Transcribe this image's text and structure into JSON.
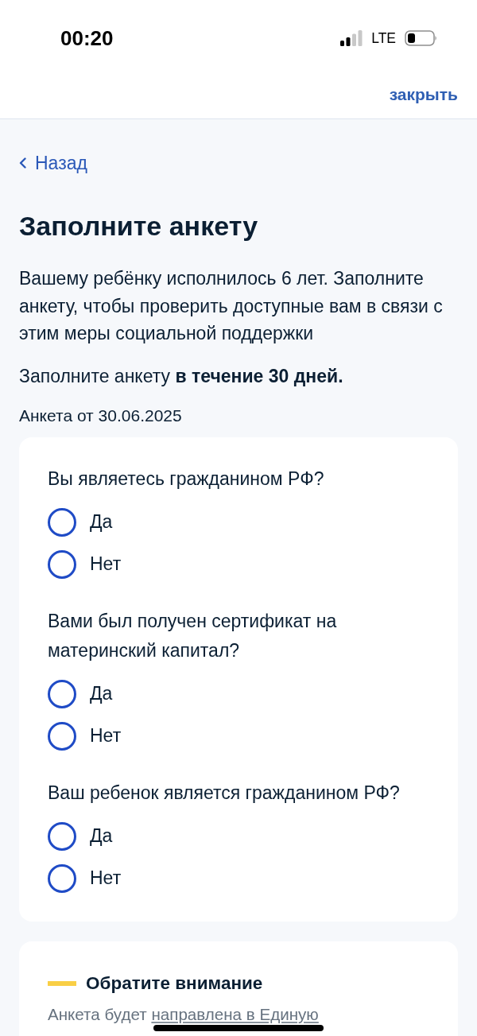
{
  "status_bar": {
    "time": "00:20",
    "network": "LTE"
  },
  "header": {
    "close_label": "закрыть"
  },
  "back_link": {
    "label": "Назад"
  },
  "title": "Заполните анкету",
  "intro": "Вашему ребёнку исполнилось 6 лет. Заполните анкету, чтобы проверить доступные вам в связи с этим меры социальной поддержки",
  "deadline": "Заполните анкету **в течение 30 дней.**",
  "form_date": "Анкета от 30.06.2025",
  "questions": [
    {
      "text": "Вы являетесь гражданином РФ?",
      "options": [
        {
          "label": "Да",
          "selected": false
        },
        {
          "label": "Нет",
          "selected": false
        }
      ]
    },
    {
      "text": "Вами был получен сертификат на материнский капитал?",
      "options": [
        {
          "label": "Да",
          "selected": false
        },
        {
          "label": "Нет",
          "selected": false
        }
      ]
    },
    {
      "text": "Ваш ребенок является гражданином РФ?",
      "options": [
        {
          "label": "Да",
          "selected": false
        },
        {
          "label": "Нет",
          "selected": false
        }
      ]
    }
  ],
  "notice": {
    "title": "Обратите внимание",
    "text": "Анкета будет",
    "link": "направлена в Единую"
  }
}
